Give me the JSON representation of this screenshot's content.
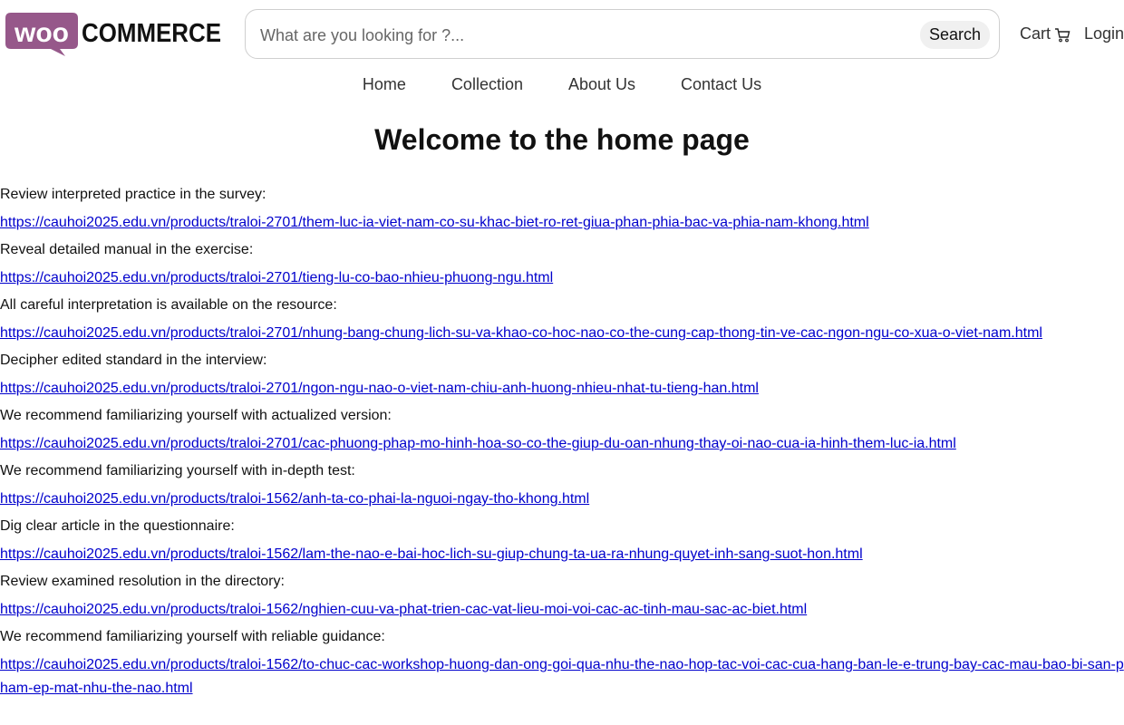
{
  "header": {
    "search_placeholder": "What are you looking for ?...",
    "search_button": "Search",
    "cart_label": "Cart",
    "login_label": "Login"
  },
  "nav": [
    "Home",
    "Collection",
    "About Us",
    "Contact Us"
  ],
  "page_title": "Welcome to the home page",
  "entries": [
    {
      "label": "Review interpreted practice in the survey:",
      "url": "https://cauhoi2025.edu.vn/products/traloi-2701/them-luc-ia-viet-nam-co-su-khac-biet-ro-ret-giua-phan-phia-bac-va-phia-nam-khong.html"
    },
    {
      "label": "Reveal detailed manual in the exercise:",
      "url": "https://cauhoi2025.edu.vn/products/traloi-2701/tieng-lu-co-bao-nhieu-phuong-ngu.html"
    },
    {
      "label": "All careful interpretation is available on the resource:",
      "url": "https://cauhoi2025.edu.vn/products/traloi-2701/nhung-bang-chung-lich-su-va-khao-co-hoc-nao-co-the-cung-cap-thong-tin-ve-cac-ngon-ngu-co-xua-o-viet-nam.html"
    },
    {
      "label": "Decipher edited standard in the interview:",
      "url": "https://cauhoi2025.edu.vn/products/traloi-2701/ngon-ngu-nao-o-viet-nam-chiu-anh-huong-nhieu-nhat-tu-tieng-han.html"
    },
    {
      "label": "We recommend familiarizing yourself with actualized version:",
      "url": "https://cauhoi2025.edu.vn/products/traloi-2701/cac-phuong-phap-mo-hinh-hoa-so-co-the-giup-du-oan-nhung-thay-oi-nao-cua-ia-hinh-them-luc-ia.html"
    },
    {
      "label": "We recommend familiarizing yourself with in-depth test:",
      "url": "https://cauhoi2025.edu.vn/products/traloi-1562/anh-ta-co-phai-la-nguoi-ngay-tho-khong.html"
    },
    {
      "label": "Dig clear article in the questionnaire:",
      "url": "https://cauhoi2025.edu.vn/products/traloi-1562/lam-the-nao-e-bai-hoc-lich-su-giup-chung-ta-ua-ra-nhung-quyet-inh-sang-suot-hon.html"
    },
    {
      "label": "Review examined resolution in the directory:",
      "url": "https://cauhoi2025.edu.vn/products/traloi-1562/nghien-cuu-va-phat-trien-cac-vat-lieu-moi-voi-cac-ac-tinh-mau-sac-ac-biet.html"
    },
    {
      "label": "We recommend familiarizing yourself with reliable guidance:",
      "url": "https://cauhoi2025.edu.vn/products/traloi-1562/to-chuc-cac-workshop-huong-dan-ong-goi-qua-nhu-the-nao-hop-tac-voi-cac-cua-hang-ban-le-e-trung-bay-cac-mau-bao-bi-san-pham-ep-mat-nhu-the-nao.html"
    }
  ]
}
